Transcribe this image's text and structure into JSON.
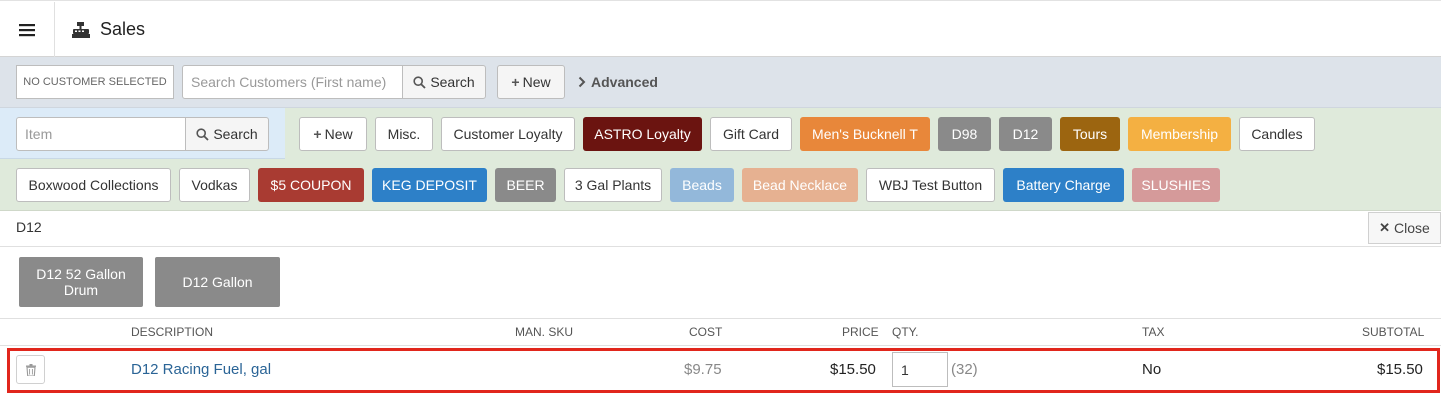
{
  "app": {
    "title": "Sales"
  },
  "customer": {
    "selected_label": "NO CUSTOMER SELECTED",
    "search_placeholder": "Search Customers (First name)",
    "search_label": "Search",
    "new_label": "New",
    "advanced_label": "Advanced"
  },
  "item": {
    "search_placeholder": "Item",
    "search_label": "Search"
  },
  "shortcuts_row1": [
    {
      "label": "New",
      "color": "#ffffff"
    },
    {
      "label": "Misc.",
      "color": "#ffffff"
    },
    {
      "label": "Customer Loyalty",
      "color": "#ffffff"
    },
    {
      "label": "ASTRO Loyalty",
      "color": "#6b1410"
    },
    {
      "label": "Gift Card",
      "color": "#ffffff"
    },
    {
      "label": "Men's Bucknell T",
      "color": "#e8873a"
    },
    {
      "label": "D98",
      "color": "#8a8a8a"
    },
    {
      "label": "D12",
      "color": "#8a8a8a"
    },
    {
      "label": "Tours",
      "color": "#9c6510"
    },
    {
      "label": "Membership",
      "color": "#f4b042"
    },
    {
      "label": "Candles",
      "color": "#ffffff"
    }
  ],
  "shortcuts_row2": [
    {
      "label": "Boxwood Collections",
      "color": "#ffffff"
    },
    {
      "label": "Vodkas",
      "color": "#ffffff"
    },
    {
      "label": "$5 COUPON",
      "color": "#a93b32"
    },
    {
      "label": "KEG DEPOSIT",
      "color": "#2d80c8"
    },
    {
      "label": "BEER",
      "color": "#8a8a8a"
    },
    {
      "label": "3 Gal Plants",
      "color": "#ffffff"
    },
    {
      "label": "Beads",
      "color": "#93b8da"
    },
    {
      "label": "Bead Necklace",
      "color": "#e6b191"
    },
    {
      "label": "WBJ Test Button",
      "color": "#ffffff"
    },
    {
      "label": "Battery Charge",
      "color": "#2d80c8"
    },
    {
      "label": "SLUSHIES",
      "color": "#d59a9a"
    }
  ],
  "category": {
    "name": "D12",
    "close_label": "Close",
    "tiles": [
      "D12 52 Gallon Drum",
      "D12 Gallon"
    ]
  },
  "cart": {
    "columns": [
      "DESCRIPTION",
      "MAN. SKU",
      "COST",
      "PRICE",
      "QTY.",
      "TAX",
      "SUBTOTAL"
    ],
    "rows": [
      {
        "description": "D12 Racing Fuel, gal",
        "man_sku": "",
        "cost": "$9.75",
        "price": "$15.50",
        "qty": "1",
        "stock": "(32)",
        "tax": "No",
        "subtotal": "$15.50"
      }
    ]
  },
  "colors": {
    "highlight": "#e1261c",
    "link": "#2a6496"
  }
}
